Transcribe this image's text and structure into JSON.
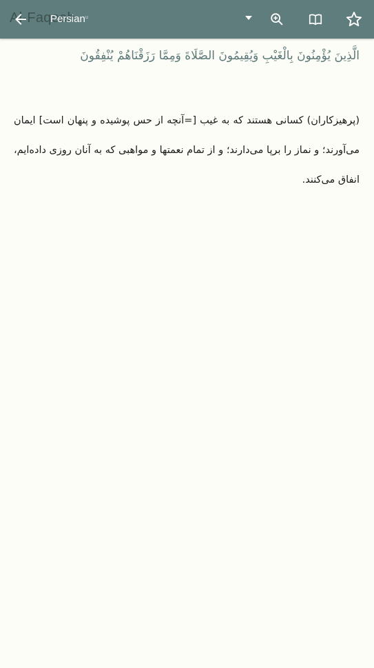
{
  "toolbar": {
    "background_title": "Al-Faqeeh",
    "sub_label": "u",
    "selected_language": "Persian",
    "back_icon": "arrow-left-icon",
    "dropdown_icon": "caret-down-icon",
    "zoom_icon": "zoom-in-icon",
    "book_icon": "open-book-icon",
    "star_icon": "star-outline-icon",
    "color": "#5f7d7d"
  },
  "verse": {
    "arabic": "الَّذِينَ يُؤْمِنُونَ بِالْغَيْبِ وَيُقِيمُونَ الصَّلَاةَ وَمِمَّا رَزَقْنَاهُمْ يُنْفِقُونَ",
    "arabic_color": "#5c7878",
    "translation": "(پرهیزکاران) کسانی هستند که به غیب [=آنچه از حس پوشیده و پنهان است] ایمان می‌آورند؛ و نماز را برپا می‌دارند؛ و از تمام نعمتها و مواهبی که به آنان روزی داده‌ایم، انفاق می‌کنند."
  },
  "page_background": "#fdfdf8"
}
